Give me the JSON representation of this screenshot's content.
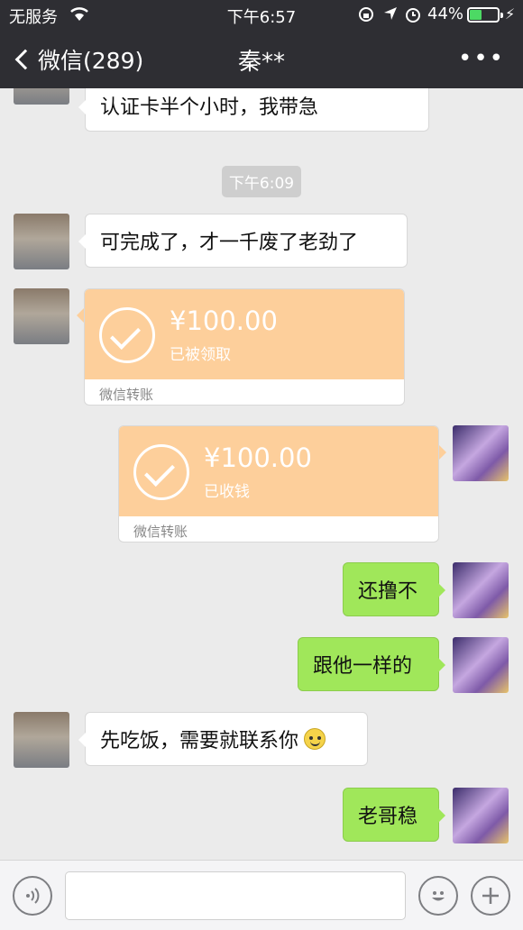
{
  "status_bar": {
    "carrier": "无服务",
    "time": "下午6:57",
    "battery_percent": "44%",
    "battery_level": 0.44
  },
  "nav": {
    "back_label": "微信(289)",
    "title": "秦**",
    "more": "•••"
  },
  "messages": {
    "m0": {
      "text": "认证卡半个小时，我带急"
    },
    "ts": {
      "text": "下午6:09"
    },
    "m1": {
      "text": "可完成了，才一千废了老劲了"
    },
    "t1": {
      "amount": "¥100.00",
      "status": "已被领取",
      "label": "微信转账"
    },
    "t2": {
      "amount": "¥100.00",
      "status": "已收钱",
      "label": "微信转账"
    },
    "m2": {
      "text": "还撸不"
    },
    "m3": {
      "text": "跟他一样的"
    },
    "m4": {
      "text": "先吃饭，需要就联系你"
    },
    "m5": {
      "text": "老哥稳"
    }
  },
  "input_bar": {
    "voice_icon": "voice-icon",
    "emoji_icon": "emoji-icon",
    "plus_icon": "plus-icon"
  },
  "colors": {
    "header": "#2e2e33",
    "chat_bg": "#ebebeb",
    "green_bubble": "#a0e75a",
    "transfer": "#fdcf9b"
  }
}
